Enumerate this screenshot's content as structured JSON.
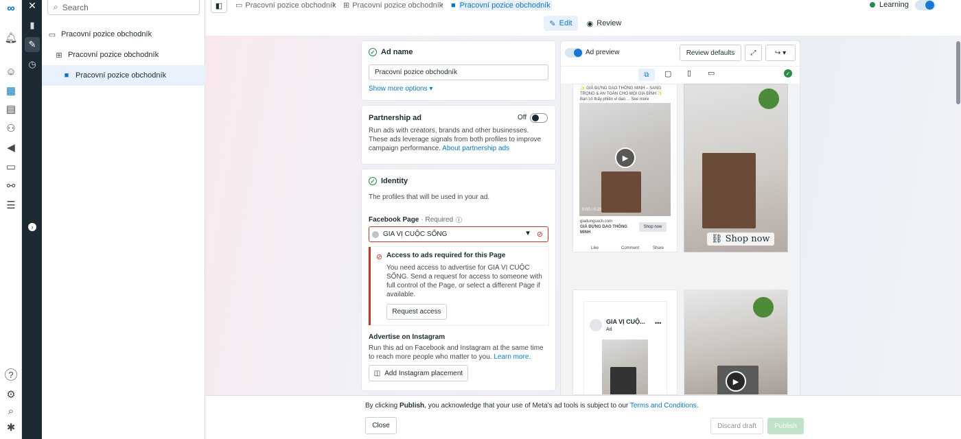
{
  "rail_icons": {
    "meta_logo": "meta-logo",
    "close": "close-icon",
    "items": [
      "bell-icon",
      "smiley-icon",
      "table-icon",
      "catalog-icon",
      "people-icon",
      "megaphone-icon",
      "card-icon",
      "network-icon",
      "menu-icon",
      "help-icon",
      "gear-icon",
      "search-icon",
      "bug-icon"
    ],
    "secondary": [
      "chart-icon",
      "pencil-icon",
      "clock-icon",
      "expand-icon"
    ]
  },
  "tree": {
    "search_placeholder": "Search",
    "items": [
      {
        "label": "Pracovní pozice obchodník",
        "icon": "folder-icon"
      },
      {
        "label": "Pracovní pozice obchodník",
        "icon": "grid-icon"
      },
      {
        "label": "Pracovní pozice obchodník",
        "icon": "ad-icon"
      }
    ]
  },
  "breadcrumb": [
    {
      "label": "Pracovní pozice obchodník",
      "icon": "folder-icon"
    },
    {
      "label": "Pracovní pozice obchodník",
      "icon": "grid-icon"
    },
    {
      "label": "Pracovní pozice obchodník",
      "icon": "ad-icon"
    }
  ],
  "header": {
    "learning_label": "Learning",
    "learning_color": "#2a8a4a",
    "accent": "#1877d2",
    "edit_tab": "Edit",
    "review_tab": "Review"
  },
  "ad_name": {
    "title": "Ad name",
    "value": "Pracovní pozice obchodník",
    "more_options": "Show more options"
  },
  "partnership": {
    "title": "Partnership ad",
    "toggle_label": "Off",
    "description": "Run ads with creators, brands and other businesses. These ads leverage signals from both profiles to improve campaign performance.",
    "link": "About partnership ads"
  },
  "identity": {
    "title": "Identity",
    "subtitle": "The profiles that will be used in your ad.",
    "fb_label": "Facebook Page",
    "required": "· Required",
    "fb_value": "GIA VỊ CUỘC SỐNG",
    "error_title": "Access to ads required for this Page",
    "error_text": "You need access to advertise for GIA VỊ CUỘC SỐNG. Send a request for access to someone with full control of the Page, or select a different Page if available.",
    "request_button": "Request access",
    "ig_title": "Advertise on Instagram",
    "ig_text": "Run this ad on Facebook and Instagram at the same time to reach more people who matter to you.",
    "ig_link": "Learn more.",
    "ig_button": "Add Instagram placement"
  },
  "preview": {
    "title": "Ad preview",
    "review_defaults": "Review defaults",
    "tile1": {
      "caption": "✨ GIÁ ĐỰNG DAO THÔNG MINH – SANG TRỌNG & AN TOÀN CHO MỌI GIA ĐÌNH ✨ Bạn có thấy phiền vì dao ... See more",
      "time": "0:00 / 0:20",
      "domain": "giadungsach.com",
      "headline": "GIÁ ĐỰNG DAO THÔNG MINH",
      "cta": "Shop now",
      "like": "Like",
      "comment": "Comment",
      "share": "Share"
    },
    "shop_now": "Shop now",
    "tile3": {
      "page_name": "GIA VỊ CUỘ...",
      "sponsored": "Ad"
    }
  },
  "footer": {
    "disclaimer_prefix": "By clicking",
    "disclaimer_bold": "Publish",
    "disclaimer_middle": ", you acknowledge that your use of Meta's ad tools is subject to our",
    "terms_link": "Terms and Conditions",
    "disclaimer_end": ".",
    "close": "Close",
    "discard": "Discard draft",
    "publish": "Publish"
  }
}
